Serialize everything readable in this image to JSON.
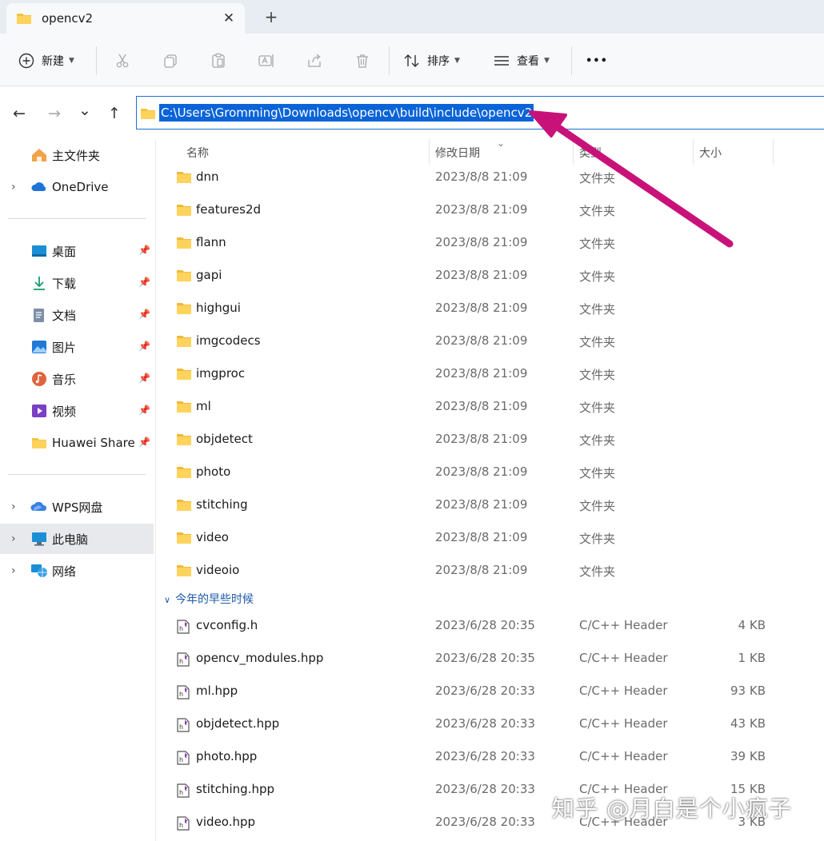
{
  "window": {
    "tab_title": "opencv2",
    "close_glyph": "✕",
    "new_tab_glyph": "+"
  },
  "toolbar": {
    "new_label": "新建",
    "sort_label": "排序",
    "view_label": "查看",
    "more_glyph": "•••",
    "icons": [
      "cut-icon",
      "copy-icon",
      "paste-icon",
      "rename-icon",
      "share-icon",
      "delete-icon"
    ]
  },
  "address": {
    "path": "C:\\Users\\Gromming\\Downloads\\opencv\\build\\include\\opencv2",
    "selection_color": "#0a64d8"
  },
  "nav_glyphs": {
    "back": "←",
    "forward": "→",
    "recent": "⌄",
    "up": "↑"
  },
  "sidebar": {
    "home": "主文件夹",
    "onedrive": "OneDrive",
    "quick": [
      {
        "label": "桌面",
        "icon": "desktop-icon"
      },
      {
        "label": "下载",
        "icon": "download-icon"
      },
      {
        "label": "文档",
        "icon": "document-icon"
      },
      {
        "label": "图片",
        "icon": "pictures-icon"
      },
      {
        "label": "音乐",
        "icon": "music-icon"
      },
      {
        "label": "视频",
        "icon": "video-icon"
      },
      {
        "label": "Huawei Share",
        "icon": "folder-icon"
      }
    ],
    "wps": "WPS网盘",
    "this_pc": "此电脑",
    "network": "网络"
  },
  "columns": {
    "name": "名称",
    "date": "修改日期",
    "type": "类型",
    "size": "大小"
  },
  "folders": [
    {
      "name": "dnn",
      "date": "2023/8/8 21:09",
      "type": "文件夹"
    },
    {
      "name": "features2d",
      "date": "2023/8/8 21:09",
      "type": "文件夹"
    },
    {
      "name": "flann",
      "date": "2023/8/8 21:09",
      "type": "文件夹"
    },
    {
      "name": "gapi",
      "date": "2023/8/8 21:09",
      "type": "文件夹"
    },
    {
      "name": "highgui",
      "date": "2023/8/8 21:09",
      "type": "文件夹"
    },
    {
      "name": "imgcodecs",
      "date": "2023/8/8 21:09",
      "type": "文件夹"
    },
    {
      "name": "imgproc",
      "date": "2023/8/8 21:09",
      "type": "文件夹"
    },
    {
      "name": "ml",
      "date": "2023/8/8 21:09",
      "type": "文件夹"
    },
    {
      "name": "objdetect",
      "date": "2023/8/8 21:09",
      "type": "文件夹"
    },
    {
      "name": "photo",
      "date": "2023/8/8 21:09",
      "type": "文件夹"
    },
    {
      "name": "stitching",
      "date": "2023/8/8 21:09",
      "type": "文件夹"
    },
    {
      "name": "video",
      "date": "2023/8/8 21:09",
      "type": "文件夹"
    },
    {
      "name": "videoio",
      "date": "2023/8/8 21:09",
      "type": "文件夹"
    }
  ],
  "group_label": "今年的早些时候",
  "files": [
    {
      "name": "cvconfig.h",
      "date": "2023/6/28 20:35",
      "type": "C/C++ Header",
      "size": "4 KB"
    },
    {
      "name": "opencv_modules.hpp",
      "date": "2023/6/28 20:35",
      "type": "C/C++ Header",
      "size": "1 KB"
    },
    {
      "name": "ml.hpp",
      "date": "2023/6/28 20:33",
      "type": "C/C++ Header",
      "size": "93 KB"
    },
    {
      "name": "objdetect.hpp",
      "date": "2023/6/28 20:33",
      "type": "C/C++ Header",
      "size": "43 KB"
    },
    {
      "name": "photo.hpp",
      "date": "2023/6/28 20:33",
      "type": "C/C++ Header",
      "size": "39 KB"
    },
    {
      "name": "stitching.hpp",
      "date": "2023/6/28 20:33",
      "type": "C/C++ Header",
      "size": "15 KB"
    },
    {
      "name": "video.hpp",
      "date": "2023/6/28 20:33",
      "type": "C/C++ Header",
      "size": "3 KB"
    }
  ],
  "watermark": "知乎 @月白是个小疯子",
  "colors": {
    "annotation_arrow": "#c8127a",
    "folder": "#f4c242",
    "accent": "#1e6fd0"
  }
}
